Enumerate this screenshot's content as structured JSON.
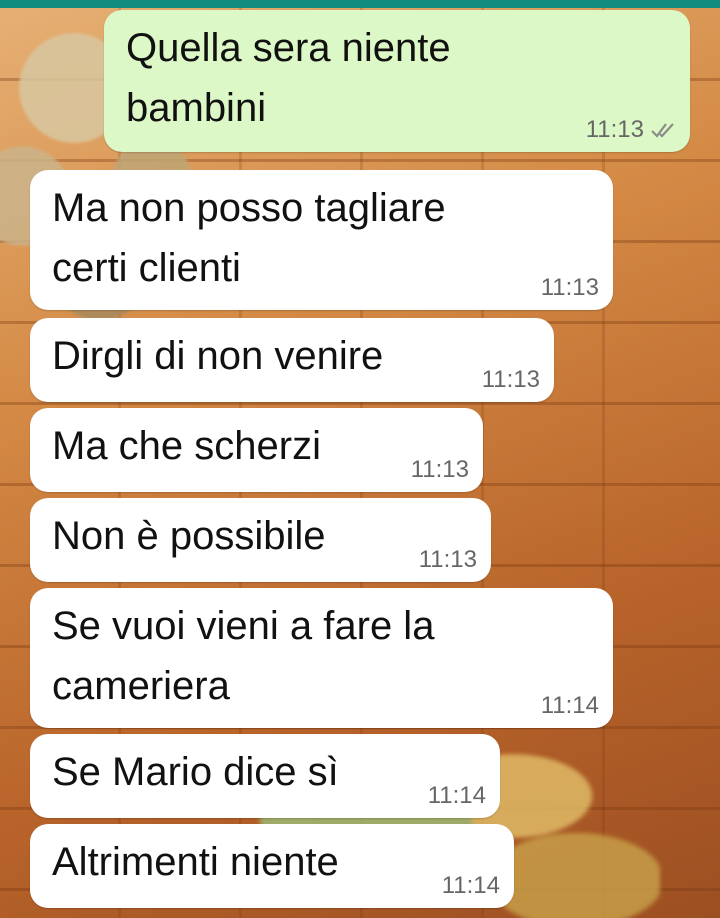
{
  "colors": {
    "header_accent": "#128c7e",
    "outgoing_bubble": "#dcf8c6",
    "incoming_bubble": "#ffffff",
    "timestamp": "#666666",
    "read_ticks": "#8c8c8c"
  },
  "messages": [
    {
      "direction": "outgoing",
      "text": "Quella sera niente\nbambini",
      "time": "11:13",
      "status": "delivered",
      "status_icon": "double-check-icon"
    },
    {
      "direction": "incoming",
      "text": "Ma non posso tagliare\ncerti clienti",
      "time": "11:13"
    },
    {
      "direction": "incoming",
      "text": "Dirgli di non venire",
      "time": "11:13"
    },
    {
      "direction": "incoming",
      "text": "Ma che scherzi",
      "time": "11:13"
    },
    {
      "direction": "incoming",
      "text": "Non è possibile",
      "time": "11:13"
    },
    {
      "direction": "incoming",
      "text": "Se vuoi vieni a fare la\ncameriera",
      "time": "11:14"
    },
    {
      "direction": "incoming",
      "text": "Se Mario dice sì",
      "time": "11:14"
    },
    {
      "direction": "incoming",
      "text": "Altrimenti niente",
      "time": "11:14"
    }
  ]
}
